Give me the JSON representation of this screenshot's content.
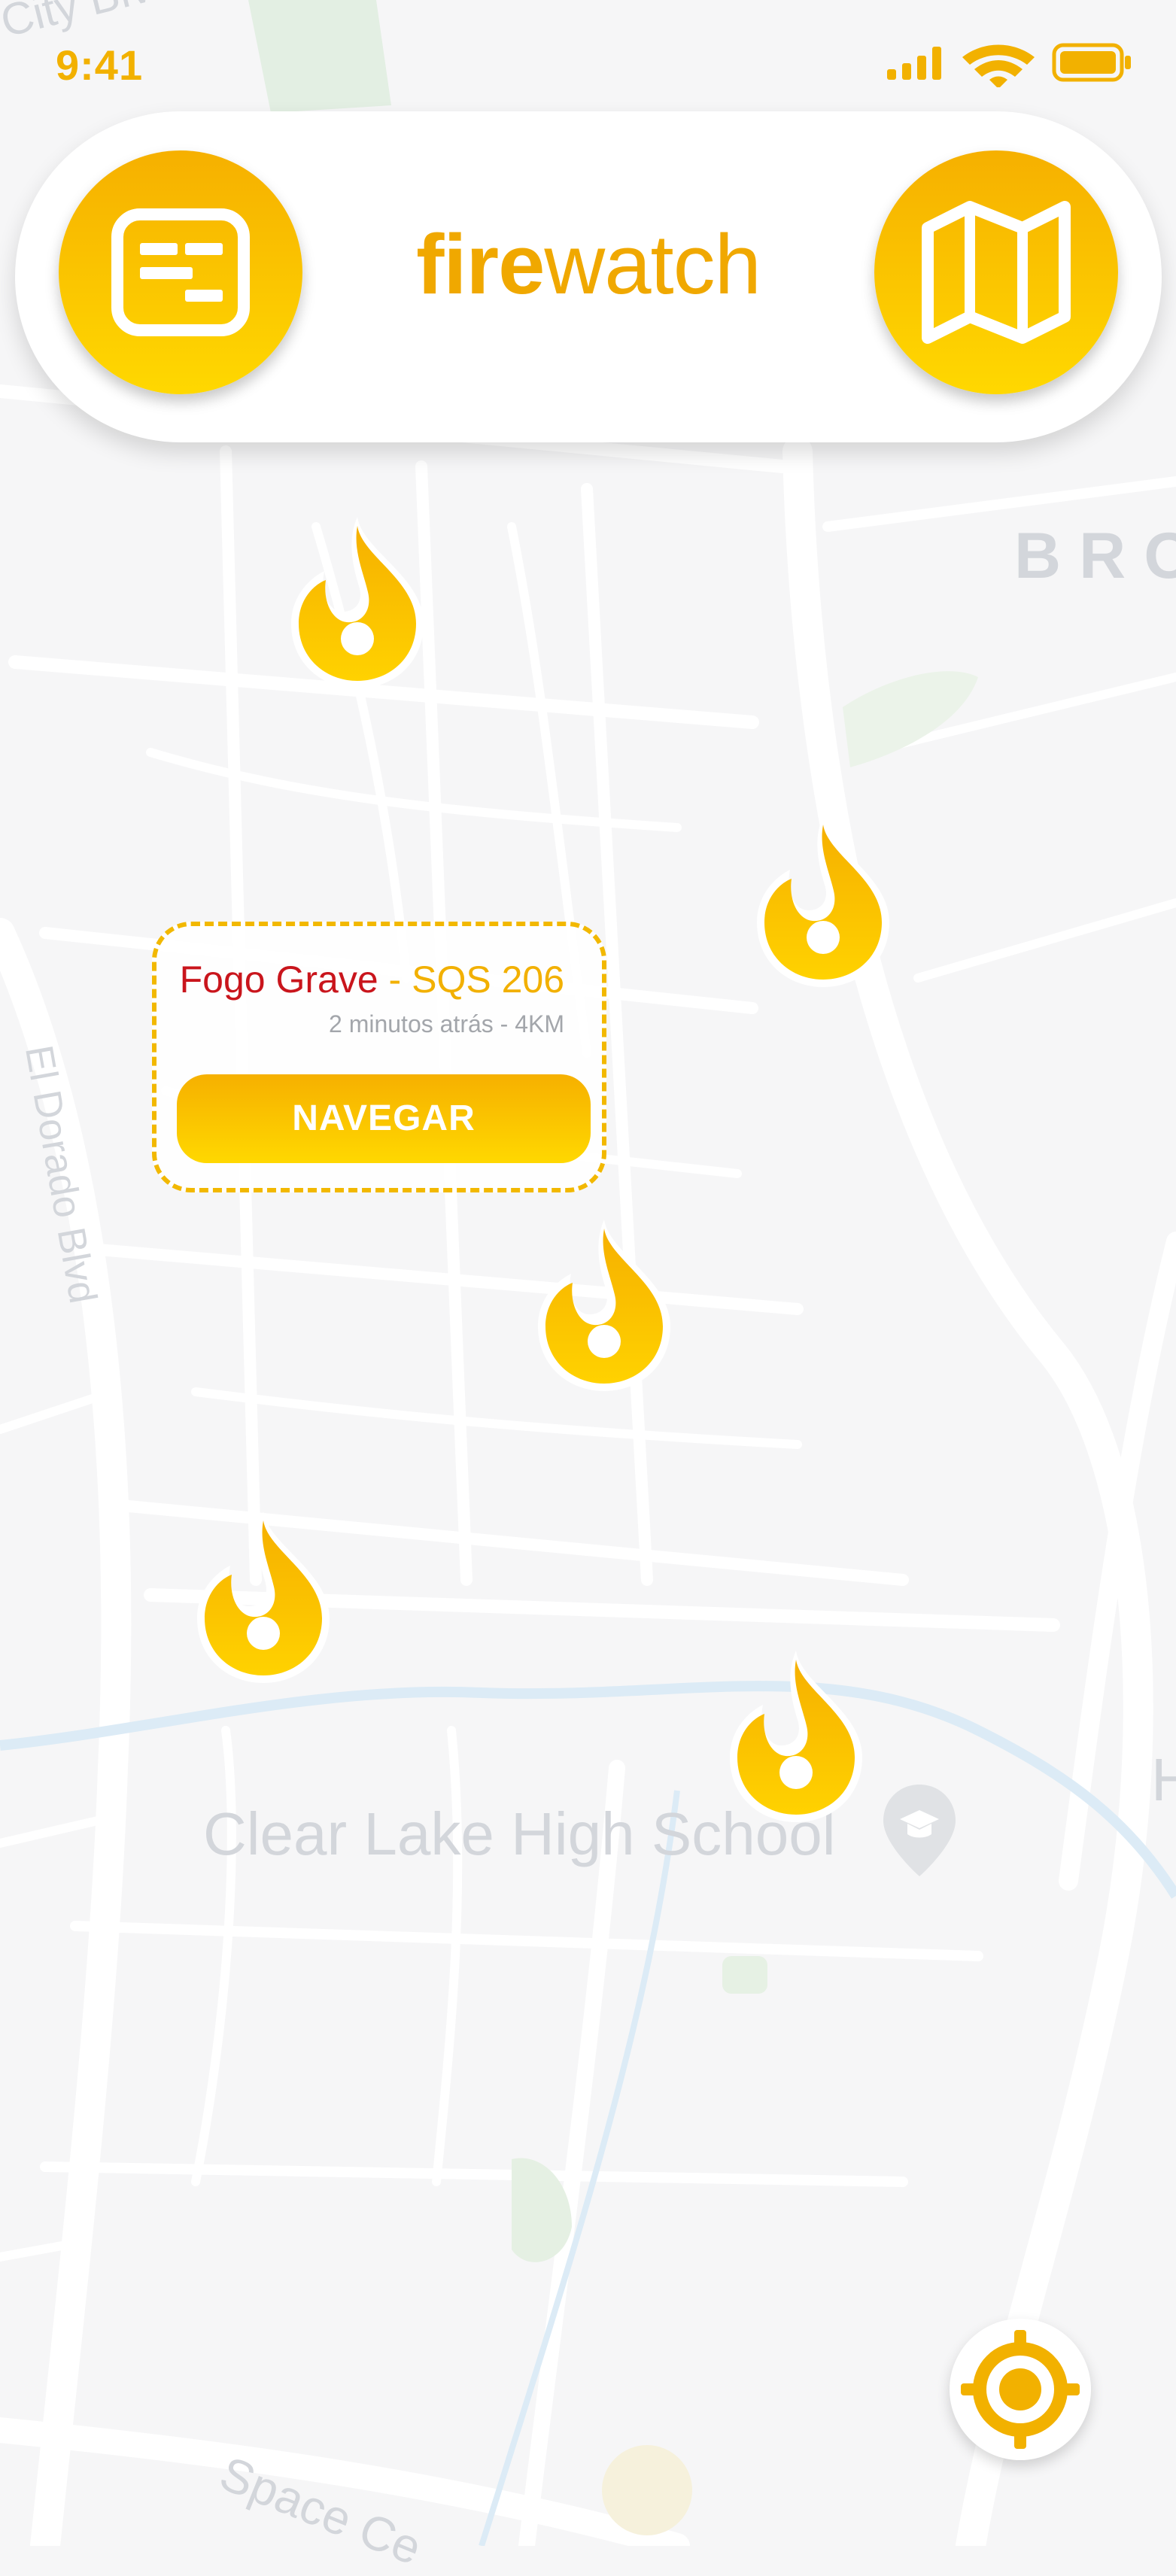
{
  "status_bar": {
    "time": "9:41"
  },
  "header": {
    "brand_bold": "fire",
    "brand_regular": "watch",
    "left_button_icon": "news-list-icon",
    "right_button_icon": "map-icon"
  },
  "map": {
    "labels": [
      {
        "text": "City Blvd"
      },
      {
        "text": "BRO"
      },
      {
        "text": "El Dorado Blvd"
      },
      {
        "text": "Clear Lake High School"
      },
      {
        "text": "H"
      },
      {
        "text": "Space Ce"
      }
    ],
    "poi_icon": "school-pin-icon"
  },
  "fire_markers": [
    {
      "icon": "fire-icon"
    },
    {
      "icon": "fire-icon"
    },
    {
      "icon": "fire-icon"
    },
    {
      "icon": "fire-icon"
    },
    {
      "icon": "fire-icon"
    }
  ],
  "popup": {
    "severity": "Fogo Grave",
    "separator": " - ",
    "location": "SQS 206",
    "meta": "2 minutos atrás - 4KM",
    "navigate_label": "NAVEGAR"
  },
  "locate_button": {
    "icon": "crosshair-locate-icon"
  },
  "colors": {
    "accent": "#F2B000",
    "accent_light": "#FFD800",
    "alert_red": "#C9151C",
    "map_background": "#F6F6F7"
  }
}
